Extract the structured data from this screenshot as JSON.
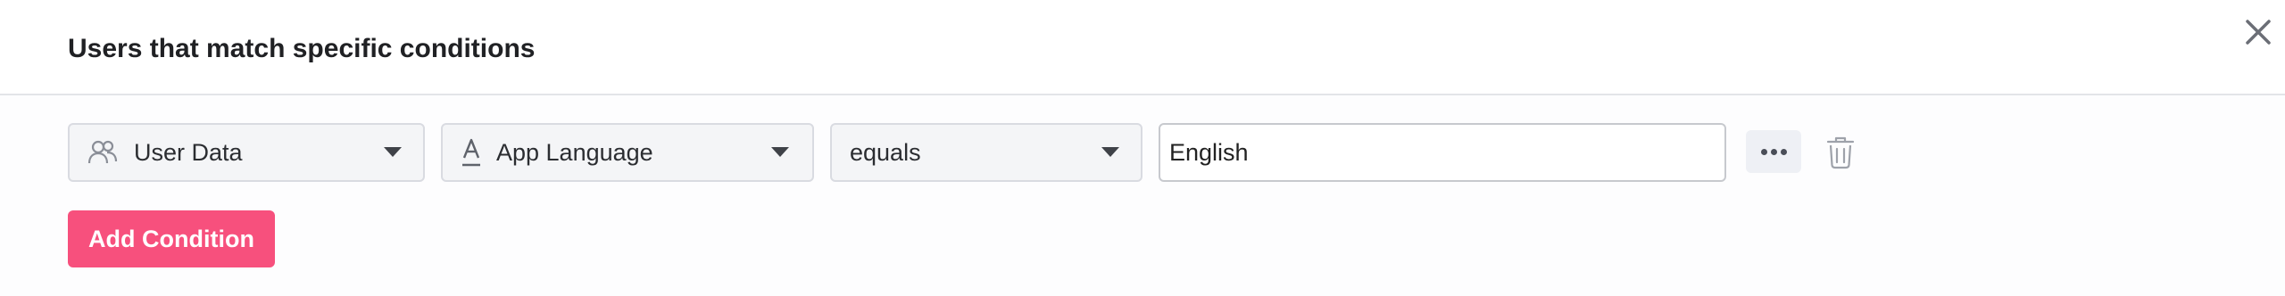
{
  "dialog": {
    "title": "Users that match specific conditions",
    "close_icon": "close-icon"
  },
  "condition": {
    "source": {
      "label": "User Data",
      "icon": "users-icon"
    },
    "attribute": {
      "label": "App Language",
      "icon": "text-attribute-icon"
    },
    "operator": {
      "label": "equals"
    },
    "value": "English",
    "more_icon": "more-horizontal-icon",
    "delete_icon": "trash-icon"
  },
  "actions": {
    "add_condition_label": "Add Condition"
  },
  "colors": {
    "primary": "#f7507d",
    "border": "#d9dbe1",
    "select_bg": "#f4f5f7"
  }
}
